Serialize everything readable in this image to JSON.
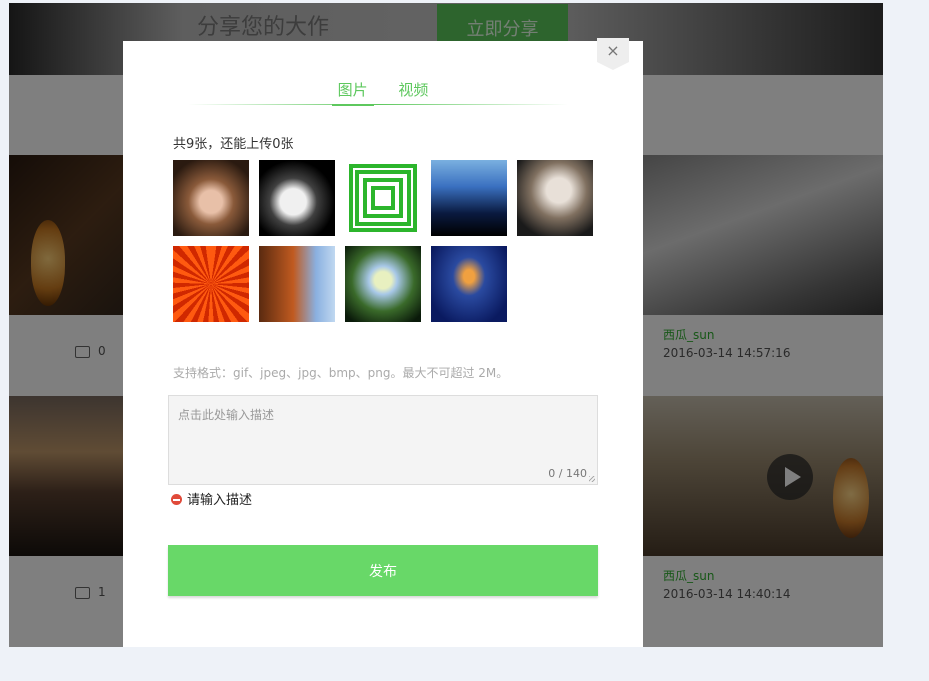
{
  "background_page": {
    "banner": {
      "title": "分享您的大作",
      "share_button": "立即分享"
    },
    "posts": [
      {
        "username": "西瓜_sun",
        "timestamp": "2016-03-14 14:57:16",
        "comment_count": "0"
      },
      {
        "username": "西瓜_sun",
        "timestamp": "2016-03-14 14:40:14",
        "comment_count": "1"
      }
    ]
  },
  "modal": {
    "close_symbol": "×",
    "tabs": [
      {
        "label": "图片",
        "active": true
      },
      {
        "label": "视频",
        "active": false
      }
    ],
    "upload_count_text": "共9张，还能上传0张",
    "thumbnails": [
      {
        "name": "thumb-portrait-glasses"
      },
      {
        "name": "thumb-bw-face"
      },
      {
        "name": "thumb-green-squares"
      },
      {
        "name": "thumb-night-city"
      },
      {
        "name": "thumb-white-dress"
      },
      {
        "name": "thumb-orange-flower"
      },
      {
        "name": "thumb-rock-formation"
      },
      {
        "name": "thumb-hydrangea"
      },
      {
        "name": "thumb-jellyfish"
      }
    ],
    "format_hint": "支持格式：gif、jpeg、jpg、bmp、png。最大不可超过 2M。",
    "description": {
      "placeholder": "点击此处输入描述",
      "value": "",
      "counter": "0 / 140"
    },
    "error_message": "请输入描述",
    "publish_button": "发布"
  },
  "colors": {
    "accent": "#5ec85e",
    "publish_button": "#68d868",
    "error": "#e04a3a",
    "overlay": "rgba(0,0,0,0.5)",
    "username": "#2fae2f"
  }
}
